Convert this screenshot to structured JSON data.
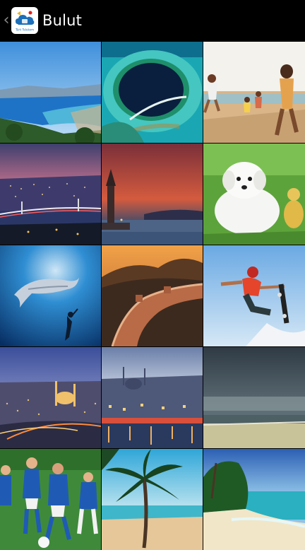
{
  "action_bar": {
    "title": "Bulut",
    "up_glyph": "‹",
    "app_icon": {
      "name": "cloud-app-icon",
      "caption": "Türk Telekom"
    }
  },
  "gallery": {
    "tiles": [
      {
        "name": "tile-coastal-bay"
      },
      {
        "name": "tile-blue-hole-atoll"
      },
      {
        "name": "tile-family-beach-run"
      },
      {
        "name": "tile-bosphorus-bridge-night"
      },
      {
        "name": "tile-maiden-tower-sunset"
      },
      {
        "name": "tile-white-puppy"
      },
      {
        "name": "tile-whale-diver"
      },
      {
        "name": "tile-great-wall"
      },
      {
        "name": "tile-skateboarder-jump"
      },
      {
        "name": "tile-istanbul-mosque-evening"
      },
      {
        "name": "tile-istanbul-waterfront"
      },
      {
        "name": "tile-stormy-beach"
      },
      {
        "name": "tile-kids-soccer"
      },
      {
        "name": "tile-palm-tree-beach"
      },
      {
        "name": "tile-tropical-shore"
      }
    ]
  }
}
